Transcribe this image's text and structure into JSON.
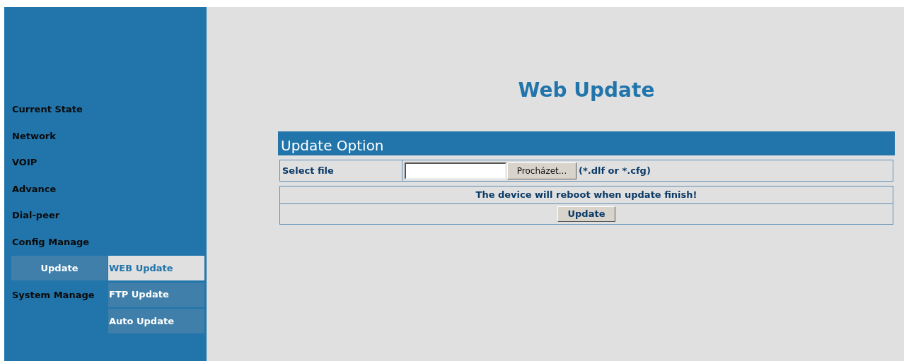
{
  "sidebar": {
    "items": [
      {
        "label": "Current State",
        "selected": false
      },
      {
        "label": "Network",
        "selected": false
      },
      {
        "label": "VOIP",
        "selected": false
      },
      {
        "label": "Advance",
        "selected": false
      },
      {
        "label": "Dial-peer",
        "selected": false
      },
      {
        "label": "Config Manage",
        "selected": false
      },
      {
        "label": "Update",
        "selected": true,
        "submenu": [
          {
            "label": "WEB Update",
            "selected": true
          },
          {
            "label": "FTP Update",
            "selected": false
          },
          {
            "label": "Auto Update",
            "selected": false
          }
        ]
      },
      {
        "label": "System Manage",
        "selected": false
      }
    ]
  },
  "page_title": "Web Update",
  "panel": {
    "title": "Update Option",
    "file_label": "Select file",
    "browse_button": "Procházet...",
    "file_hint": "(*.dlf or *.cfg)",
    "notice": "The device will reboot when update finish!",
    "update_button": "Update"
  }
}
